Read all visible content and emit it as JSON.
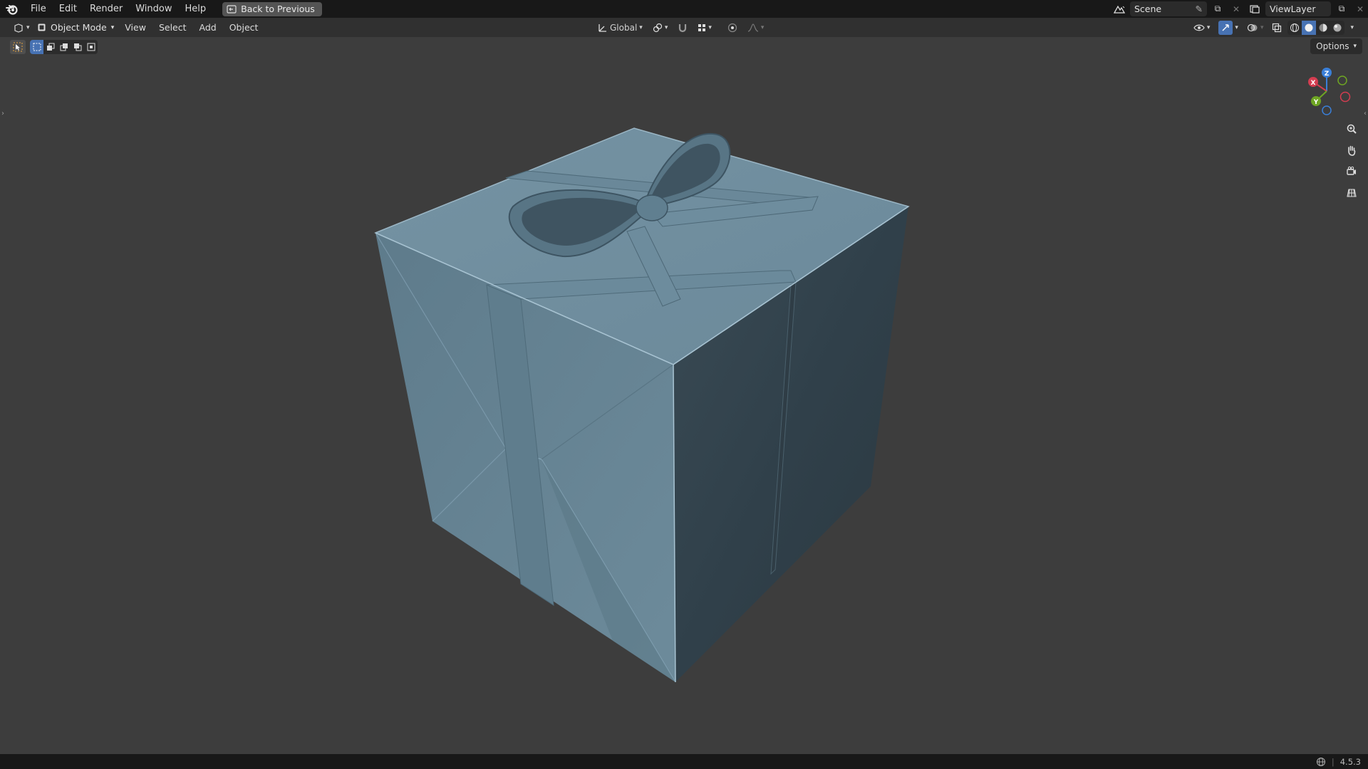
{
  "topbar": {
    "menus": [
      "File",
      "Edit",
      "Render",
      "Window",
      "Help"
    ],
    "back_label": "Back to Previous",
    "scene": "Scene",
    "view_layer": "ViewLayer"
  },
  "header": {
    "mode": "Object Mode",
    "menus": [
      "View",
      "Select",
      "Add",
      "Object"
    ],
    "orientation": "Global"
  },
  "viewport": {
    "options_label": "Options",
    "gizmo": {
      "x": "X",
      "y": "Y",
      "z": "Z"
    },
    "object_color": "#6a8594",
    "background_color": "#3d3d3d"
  },
  "status": {
    "version": "4.5.3"
  },
  "colors": {
    "accent": "#4772b3",
    "axis_x": "#d43d50",
    "axis_y": "#6ea523",
    "axis_z": "#3a7fd8"
  }
}
